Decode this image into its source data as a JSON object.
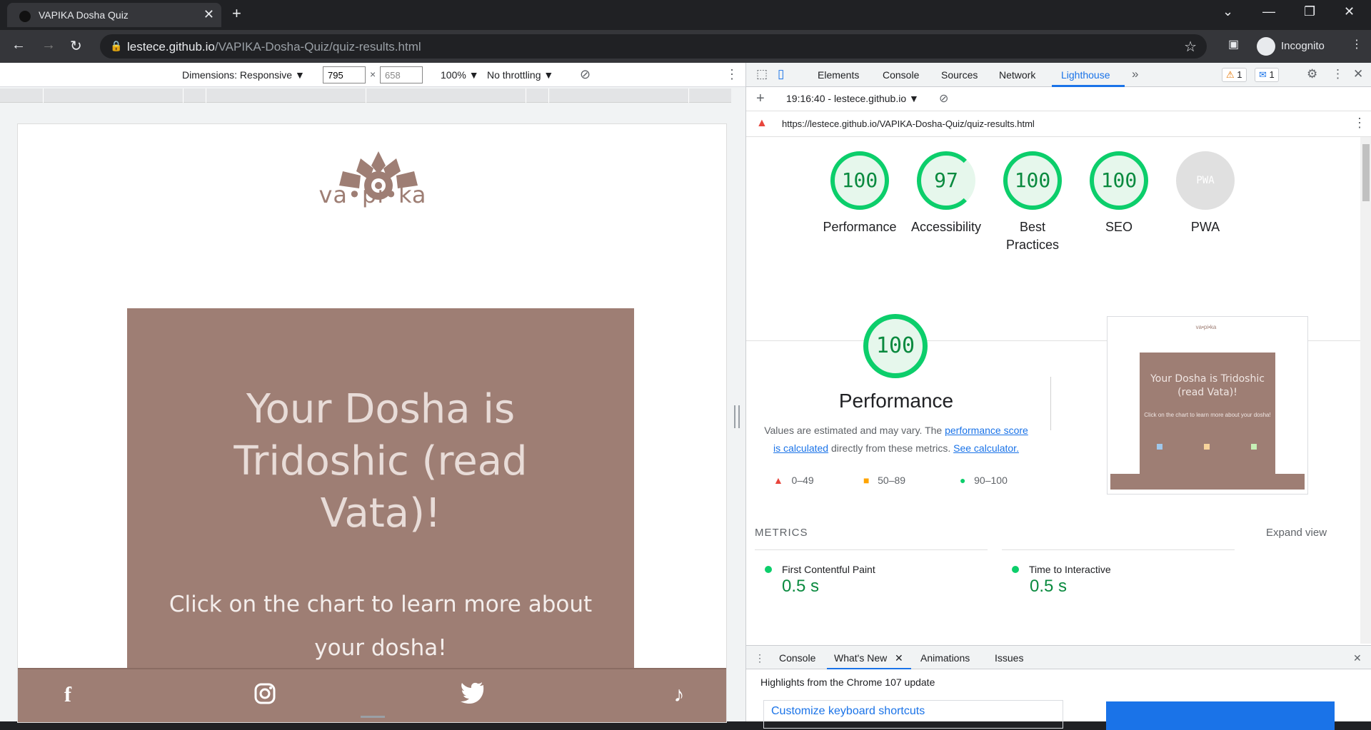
{
  "browser": {
    "tab_title": "VAPIKA Dosha Quiz",
    "url_host": "lestece.github.io",
    "url_path": "/VAPIKA-Dosha-Quiz/quiz-results.html",
    "profile": "Incognito"
  },
  "device_toolbar": {
    "dimensions_label": "Dimensions: Responsive ▼",
    "width": "795",
    "height": "658",
    "zoom": "100% ▼",
    "throttling": "No throttling ▼"
  },
  "page": {
    "logo_text": "va•pi•ka",
    "heading": "Your Dosha is Tridoshic (read Vata)!",
    "subheading": "Click on the chart to learn more about your dosha!",
    "chart_colors": [
      "#9fc7eb",
      "#f7d39b",
      "#c6f0b6"
    ],
    "social": [
      "facebook-icon",
      "instagram-icon",
      "twitter-icon",
      "tiktok-icon"
    ]
  },
  "devtools": {
    "tabs": [
      "Elements",
      "Console",
      "Sources",
      "Network",
      "Lighthouse"
    ],
    "active_tab": "Lighthouse",
    "warnings": "1",
    "messages": "1",
    "report_time": "19:16:40 - lestece.github.io ▼",
    "report_url": "https://lestece.github.io/VAPIKA-Dosha-Quiz/quiz-results.html",
    "scores": [
      {
        "label": "Performance",
        "value": "100"
      },
      {
        "label": "Accessibility",
        "value": "97"
      },
      {
        "label": "Best Practices",
        "value": "100"
      },
      {
        "label": "SEO",
        "value": "100"
      },
      {
        "label": "PWA",
        "value": "PWA"
      }
    ],
    "performance": {
      "score": "100",
      "title": "Performance",
      "desc_1": "Values are estimated and may vary. The ",
      "desc_link_1": "performance score is calculated",
      "desc_2": " directly from these metrics. ",
      "desc_link_2": "See calculator."
    },
    "legend": [
      "0–49",
      "50–89",
      "90–100"
    ],
    "screenshot": {
      "heading": "Your Dosha is Tridoshic (read Vata)!",
      "sub": "Click on the chart to learn more about your dosha!"
    },
    "metrics_title": "METRICS",
    "expand_view": "Expand view",
    "metrics": [
      {
        "label": "First Contentful Paint",
        "value": "0.5 s"
      },
      {
        "label": "Time to Interactive",
        "value": "0.5 s"
      }
    ],
    "drawer_tabs": [
      "Console",
      "What's New",
      "Animations",
      "Issues"
    ],
    "drawer_highlight": "Highlights from the Chrome 107 update",
    "drawer_card": "Customize keyboard shortcuts"
  }
}
